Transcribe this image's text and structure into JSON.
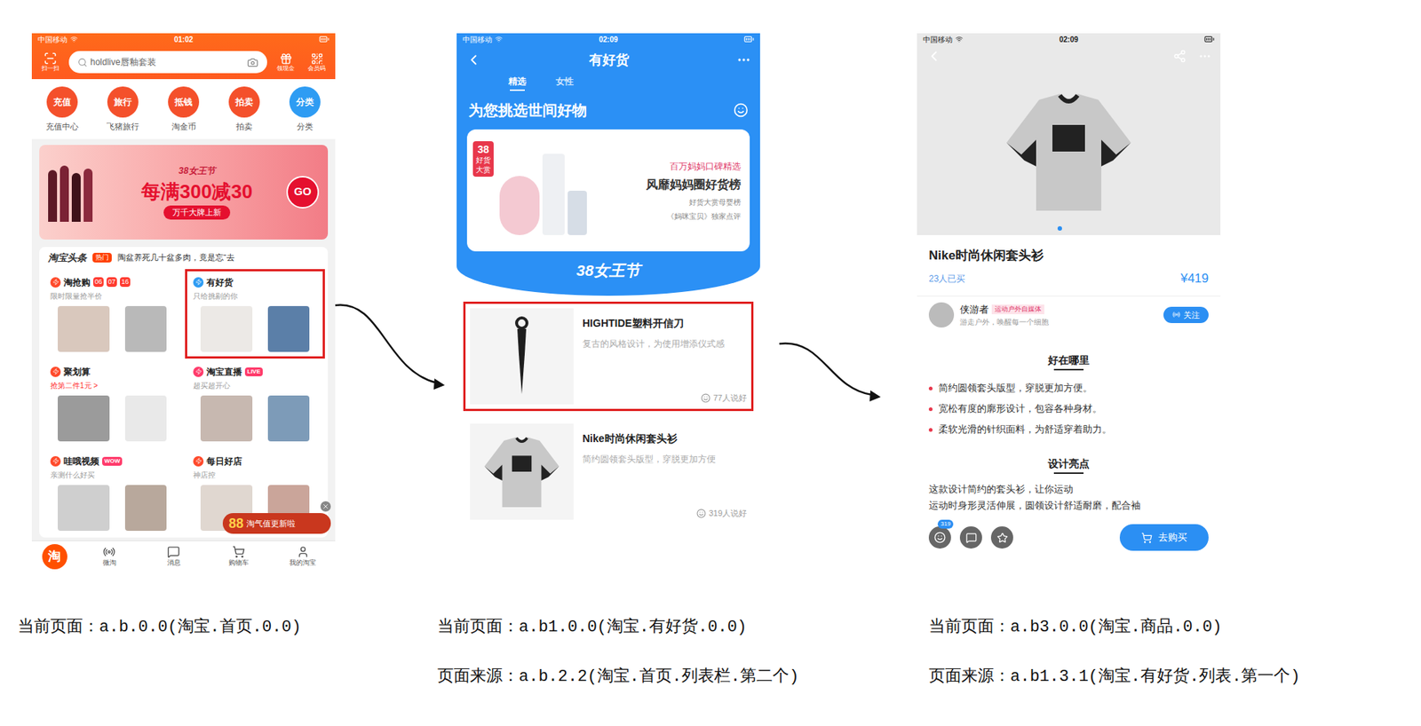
{
  "home_screen": {
    "status_bar": {
      "carrier": "中国移动",
      "time": "01:02"
    },
    "search": {
      "scan_label": "扫一扫",
      "placeholder": "holdlive唇釉套装",
      "right_labels": [
        "领现金",
        "会员码"
      ]
    },
    "shortcuts": [
      {
        "icon": "充值",
        "label": "充值中心",
        "color": "#f4502b"
      },
      {
        "icon": "旅行",
        "label": "飞猪旅行",
        "color": "#f4502b"
      },
      {
        "icon": "抵钱",
        "label": "淘金币",
        "color": "#f4502b"
      },
      {
        "icon": "拍卖",
        "label": "拍卖",
        "color": "#f4502b"
      },
      {
        "icon": "分类",
        "label": "分类",
        "color": "#2e9cf3"
      }
    ],
    "banner": {
      "tag": "38女王节",
      "headline": "每满300减30",
      "button": "GO",
      "subline": "万千大牌上新"
    },
    "headline": {
      "logo": "淘宝头条",
      "badge": "热门",
      "text": "陶盆养死几十盆多肉，竟是忘“去"
    },
    "channels": [
      {
        "title": "淘抢购",
        "subtitle": "限时限量抢半价",
        "timer": [
          "06",
          "07",
          "16"
        ],
        "badge": "",
        "color": "#ff4a2b",
        "subtitle_accent": false,
        "highlighted": false
      },
      {
        "title": "有好货",
        "subtitle": "只给挑剔的你",
        "timer": [],
        "badge": "",
        "color": "#2e9cf3",
        "subtitle_accent": false,
        "highlighted": true
      },
      {
        "title": "聚划算",
        "subtitle": "抢第二件1元 >",
        "timer": [],
        "badge": "",
        "color": "#ff4a2b",
        "subtitle_accent": true,
        "highlighted": false
      },
      {
        "title": "淘宝直播",
        "subtitle": "超买超开心",
        "timer": [],
        "badge": "LIVE",
        "color": "#ff3b6b",
        "subtitle_accent": false,
        "highlighted": false
      },
      {
        "title": "哇哦视频",
        "subtitle": "亲测什么好买",
        "timer": [],
        "badge": "WOW",
        "color": "#ff4a2b",
        "subtitle_accent": false,
        "highlighted": false
      },
      {
        "title": "每日好店",
        "subtitle": "神店控",
        "timer": [],
        "badge": "",
        "color": "#ff4a2b",
        "subtitle_accent": false,
        "highlighted": false
      }
    ],
    "floating_badge": {
      "number": "88",
      "text": "淘气值更新啦"
    },
    "tab_bar": [
      {
        "label": "淘",
        "selected": true
      },
      {
        "label": "微淘",
        "selected": false
      },
      {
        "label": "消息",
        "selected": false
      },
      {
        "label": "购物车",
        "selected": false
      },
      {
        "label": "我的淘宝",
        "selected": false
      }
    ]
  },
  "goods_screen": {
    "status_bar": {
      "carrier": "中国移动",
      "time": "02:09"
    },
    "title": "有好货",
    "tabs": [
      {
        "label": "精选",
        "selected": true
      },
      {
        "label": "女性",
        "selected": false
      }
    ],
    "heading": "为您挑选世间好物",
    "banner": {
      "tag_lines": [
        "38",
        "好货",
        "大赏"
      ],
      "kicker": "百万妈妈口碑精选",
      "headline": "风靡妈妈圈好货榜",
      "notes": [
        "好货大赏母婴榜",
        "《妈咪宝贝》独家点评"
      ]
    },
    "festival": "38女王节",
    "items": [
      {
        "title": "HIGHTIDE塑料开信刀",
        "description": "复古的风格设计，为使用增添仪式感",
        "likes": "77人说好",
        "highlighted": true
      },
      {
        "title": "Nike时尚休闲套头衫",
        "description": "简约圆领套头版型，穿脱更加方便",
        "likes": "319人说好",
        "highlighted": false
      }
    ]
  },
  "product_screen": {
    "status_bar": {
      "carrier": "中国移动",
      "time": "02:09"
    },
    "title": "Nike时尚休闲套头衫",
    "sold": "23人已买",
    "price": "¥419",
    "author": {
      "name": "侠游者",
      "tag": "运动户外自媒体",
      "bio": "游走户外，唤醒每一个细胞",
      "follow": "关注"
    },
    "sections": [
      {
        "heading": "好在哪里",
        "kind": "bullets",
        "lines": [
          "简约圆领套头版型，穿脱更加方便。",
          "宽松有度的廓形设计，包容各种身材。",
          "柔软光滑的针织面料，为舒适穿着助力。"
        ]
      },
      {
        "heading": "设计亮点",
        "kind": "paragraph",
        "lines": [
          "这款设计简约的套头衫，让你运动",
          "运动时身形灵活伸展，圆领设计舒适耐磨，配合袖"
        ]
      }
    ],
    "actions": {
      "count": "319",
      "buy": "去购买"
    }
  },
  "captions": [
    {
      "lines": [
        "当前页面：a.b.0.0(淘宝.首页.0.0)"
      ]
    },
    {
      "lines": [
        "当前页面：a.b1.0.0(淘宝.有好货.0.0)",
        "页面来源：a.b.2.2(淘宝.首页.列表栏.第二个)"
      ]
    },
    {
      "lines": [
        "当前页面：a.b3.0.0(淘宝.商品.0.0)",
        "页面来源：a.b1.3.1(淘宝.有好货.列表.第一个)"
      ]
    }
  ]
}
